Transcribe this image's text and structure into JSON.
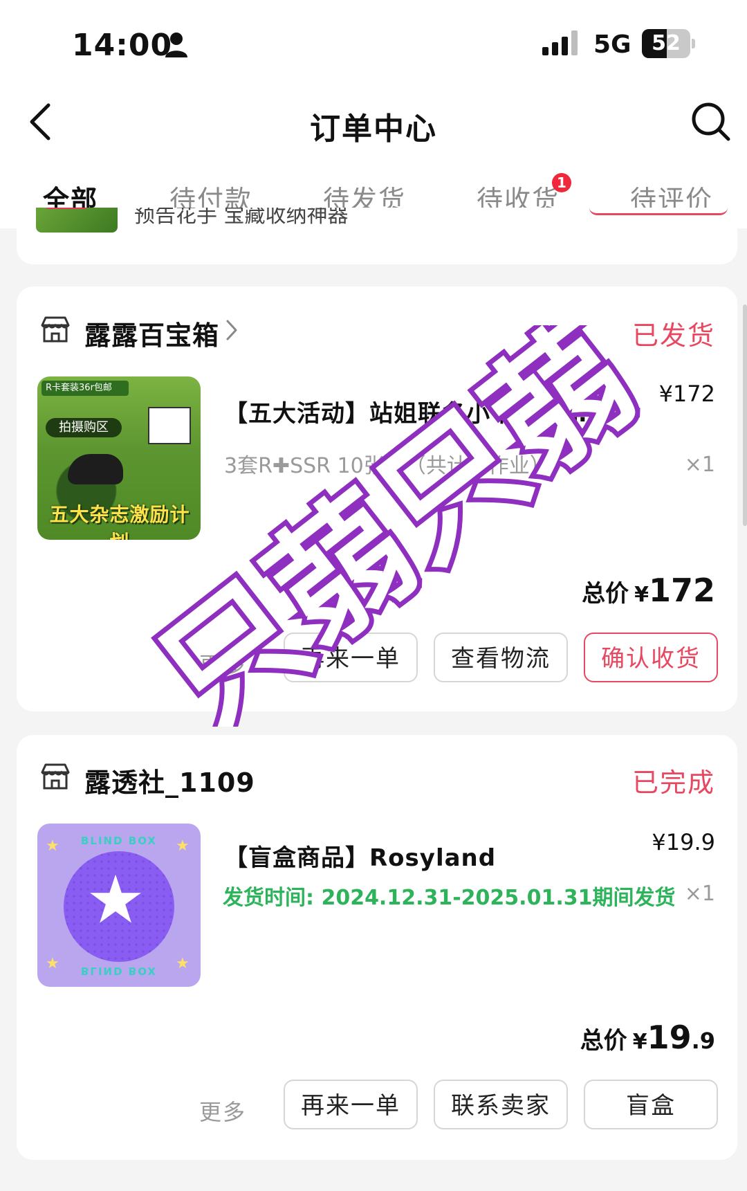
{
  "status_bar": {
    "time": "14:00",
    "network": "5G",
    "battery": "52",
    "battery_level": 0.52
  },
  "header": {
    "title": "订单中心"
  },
  "tabs": [
    {
      "label": "全部",
      "active": true
    },
    {
      "label": "待付款"
    },
    {
      "label": "待发货"
    },
    {
      "label": "待收货",
      "badge": "1"
    },
    {
      "label": "待评价"
    }
  ],
  "partial_order": {
    "product_text": "预告花手 宝藏收纳神器"
  },
  "orders": [
    {
      "store": "露露百宝箱",
      "status": "已发货",
      "product": {
        "title": "【五大活动】站姐联名小卡套组…提",
        "spec": "3套R✚SSR 10张卡（共计…作业）",
        "price": "¥172",
        "qty": "×1"
      },
      "total": {
        "label": "总价",
        "currency": "¥",
        "integer": "172",
        "decimal": ""
      },
      "buttons": [
        "更多",
        "再来一单",
        "查看物流",
        "确认收货"
      ]
    },
    {
      "store": "露透社_1109",
      "status": "已完成",
      "product": {
        "title": "【盲盒商品】Rosyland",
        "ship_time": "发货时间: 2024.12.31-2025.01.31期间发货",
        "price": "¥19.9",
        "qty": "×1",
        "image_text": "BLIND BOX"
      },
      "total": {
        "label": "总价",
        "currency": "¥",
        "integer": "19",
        "decimal": ".9"
      },
      "more": "更多",
      "buttons": [
        "再来一单",
        "联系卖家",
        "盲盒"
      ]
    }
  ],
  "thumb1": {
    "tag": "R卡套装36r包邮",
    "zone": "拍摄购区",
    "title": "五大杂志激励计划"
  },
  "watermark": {
    "text": "只蒻只蒻",
    "color": "#8e2fbf"
  },
  "colors": {
    "accent": "#e8475f",
    "ship_green": "#2db35a",
    "badge_red": "#f0283c"
  }
}
